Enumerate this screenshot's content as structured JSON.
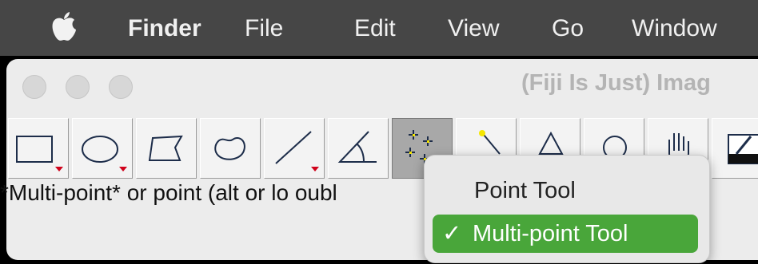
{
  "menubar": {
    "items": [
      "Finder",
      "File",
      "Edit",
      "View",
      "Go",
      "Window"
    ]
  },
  "window": {
    "title": "(Fiji Is Just) Imag",
    "status_text": "*Multi-point* or point (alt or lo                                 oubl"
  },
  "toolbar": {
    "tools": [
      {
        "icon": "rectangle-tool-icon",
        "has_arrow": true
      },
      {
        "icon": "oval-tool-icon",
        "has_arrow": true
      },
      {
        "icon": "polygon-tool-icon",
        "has_arrow": false
      },
      {
        "icon": "freehand-tool-icon",
        "has_arrow": false
      },
      {
        "icon": "line-tool-icon",
        "has_arrow": true
      },
      {
        "icon": "angle-tool-icon",
        "has_arrow": false
      },
      {
        "icon": "multi-point-tool-icon",
        "has_arrow": false,
        "pressed": true
      },
      {
        "icon": "wand-tool-icon",
        "has_arrow": false
      },
      {
        "icon": "triangle-tool-icon",
        "has_arrow": false
      },
      {
        "icon": "circle-tool-icon",
        "has_arrow": false
      },
      {
        "icon": "hand-tool-icon",
        "has_arrow": false
      },
      {
        "icon": "dropper-tool-icon",
        "has_arrow": false
      }
    ]
  },
  "popup": {
    "items": [
      {
        "label": "Point Tool",
        "selected": false
      },
      {
        "label": "Multi-point Tool",
        "selected": true,
        "check": "✓"
      }
    ]
  },
  "colors": {
    "menubar_bg": "#464646",
    "window_bg": "#ececec",
    "selected_item": "#49a63a",
    "arrow_red": "#d0021b"
  }
}
